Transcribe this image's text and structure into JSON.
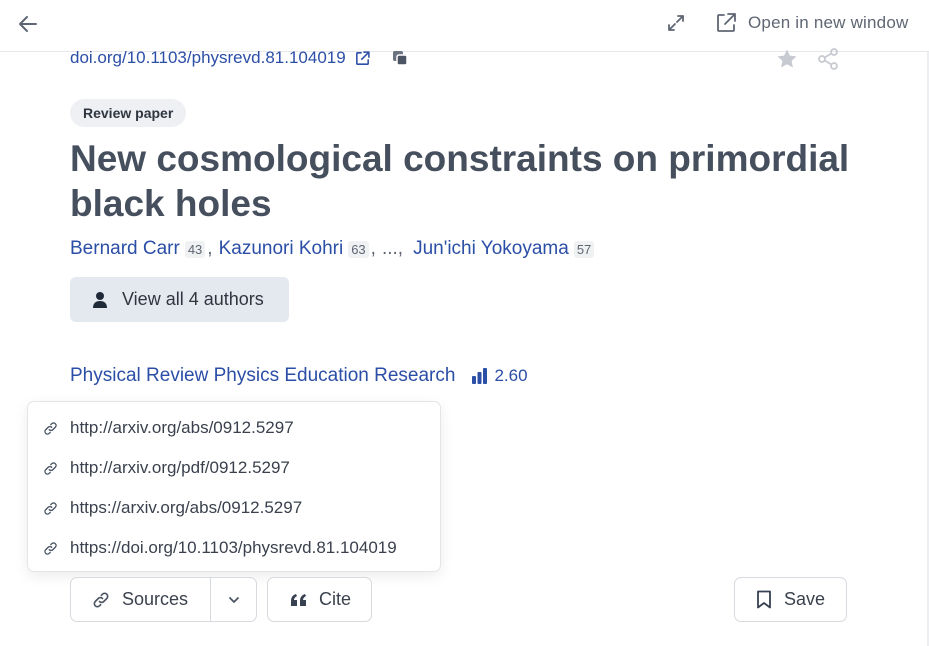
{
  "topbar": {
    "back_icon": "arrow-left-icon",
    "expand_icon": "expand-arrows-icon",
    "open_window_icon": "external-link-icon",
    "open_window_label": "Open in new window"
  },
  "paper": {
    "doi": "doi.org/10.1103/physrevd.81.104019",
    "badge": "Review paper",
    "title": "New cosmological constraints on primordial black holes",
    "authors": [
      {
        "name": "Bernard Carr",
        "hindex": "43"
      },
      {
        "name": "Kazunori Kohri",
        "hindex": "63"
      },
      {
        "name": "Jun'ichi Yokoyama",
        "hindex": "57"
      }
    ],
    "ellipsis": "...,",
    "comma": ",",
    "view_authors_label": "View all 4 authors",
    "journal": "Physical Review Physics Education Research",
    "impact": "2.60"
  },
  "sources_menu": {
    "items": [
      "http://arxiv.org/abs/0912.5297",
      "http://arxiv.org/pdf/0912.5297",
      "https://arxiv.org/abs/0912.5297",
      "https://doi.org/10.1103/physrevd.81.104019"
    ]
  },
  "actions": {
    "sources_label": "Sources",
    "cite_label": "Cite",
    "save_label": "Save"
  },
  "colors": {
    "link": "#2b4ea6",
    "title": "#464f5d",
    "button_bg": "#e4e8ef"
  }
}
